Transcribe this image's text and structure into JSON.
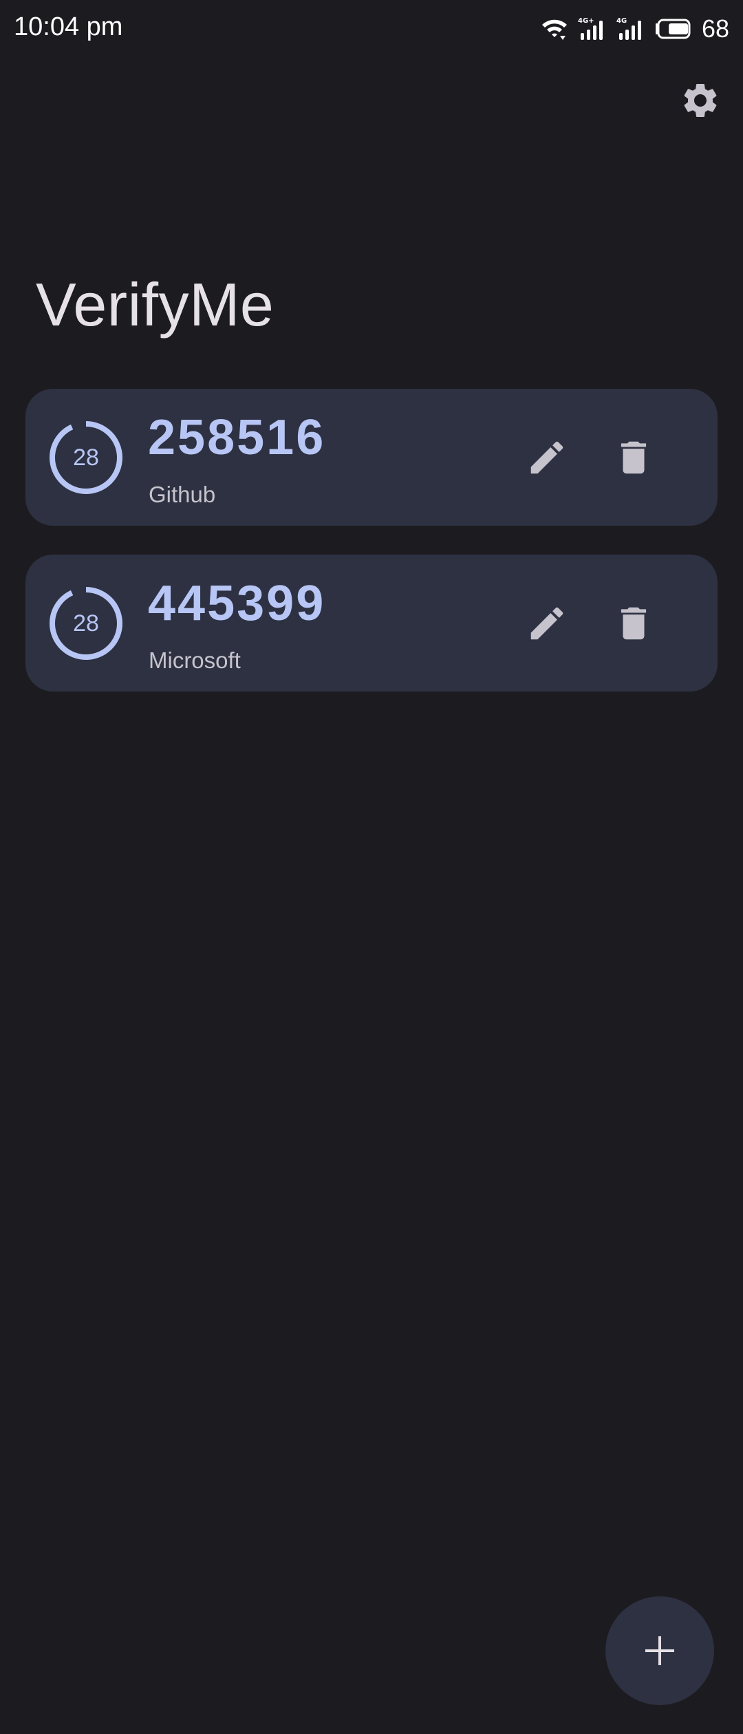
{
  "status_bar": {
    "time": "10:04 pm",
    "battery": "68",
    "battery_level": 0.68,
    "icons": [
      "wifi-icon",
      "signal-4g-icon",
      "signal-4g-icon",
      "battery-icon"
    ]
  },
  "header": {
    "settings_icon": "gear-icon",
    "title": "VerifyMe"
  },
  "tokens": [
    {
      "code": "258516",
      "account": "Github",
      "seconds_remaining": "28",
      "progress_fraction": 0.93,
      "edit_icon": "pencil-icon",
      "delete_icon": "trash-icon"
    },
    {
      "code": "445399",
      "account": "Microsoft",
      "seconds_remaining": "28",
      "progress_fraction": 0.93,
      "edit_icon": "pencil-icon",
      "delete_icon": "trash-icon"
    }
  ],
  "fab": {
    "icon": "plus-icon"
  },
  "colors": {
    "background": "#1c1b20",
    "card": "#2d3142",
    "accent": "#b8c6f5",
    "icon": "#c6c3cc"
  }
}
